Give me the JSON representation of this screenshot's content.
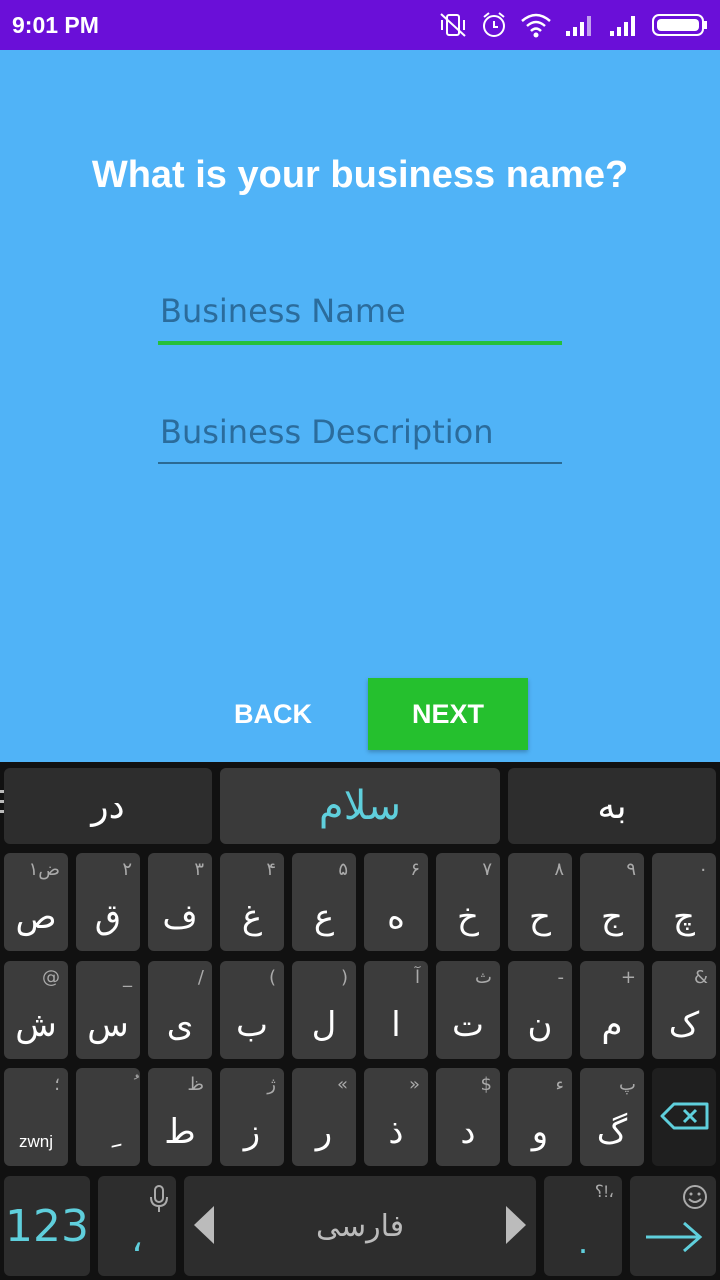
{
  "status_bar": {
    "time": "9:01 PM",
    "icons": [
      "vibrate-off-icon",
      "alarm-icon",
      "wifi-icon",
      "signal-icon",
      "signal-icon",
      "battery-icon"
    ]
  },
  "form": {
    "question": "What is your business name?",
    "name_placeholder": "Business Name",
    "description_placeholder": "Business Description",
    "back_label": "BACK",
    "next_label": "NEXT"
  },
  "colors": {
    "status_bar": "#6a0fd8",
    "background": "#50b3f7",
    "accent_green": "#25c02e",
    "keyboard_accent": "#5fcfdc"
  },
  "keyboard": {
    "suggestions": [
      "در",
      "سلام",
      "به"
    ],
    "row1": [
      {
        "main": "ص",
        "hint": "ض١"
      },
      {
        "main": "ق",
        "hint": "٢"
      },
      {
        "main": "ف",
        "hint": "٣"
      },
      {
        "main": "غ",
        "hint": "۴"
      },
      {
        "main": "ع",
        "hint": "۵"
      },
      {
        "main": "ه",
        "hint": "۶"
      },
      {
        "main": "خ",
        "hint": "٧"
      },
      {
        "main": "ح",
        "hint": "٨"
      },
      {
        "main": "ج",
        "hint": "٩"
      },
      {
        "main": "چ",
        "hint": "٠"
      }
    ],
    "row2": [
      {
        "main": "ش",
        "hint": "@"
      },
      {
        "main": "س",
        "hint": "_"
      },
      {
        "main": "ی",
        "hint": "/"
      },
      {
        "main": "ب",
        "hint": "("
      },
      {
        "main": "ل",
        "hint": ")"
      },
      {
        "main": "ا",
        "hint": "آ"
      },
      {
        "main": "ت",
        "hint": "ث"
      },
      {
        "main": "ن",
        "hint": "-"
      },
      {
        "main": "م",
        "hint": "+"
      },
      {
        "main": "ک",
        "hint": "&"
      }
    ],
    "row3": [
      {
        "main": "zwnj",
        "hint": "؛"
      },
      {
        "main": "ِ",
        "hint": "ُ"
      },
      {
        "main": "ط",
        "hint": "ظ"
      },
      {
        "main": "ز",
        "hint": "ژ"
      },
      {
        "main": "ر",
        "hint": "«"
      },
      {
        "main": "ذ",
        "hint": "»"
      },
      {
        "main": "د",
        "hint": "$"
      },
      {
        "main": "و",
        "hint": "ء"
      },
      {
        "main": "گ",
        "hint": "پ"
      }
    ],
    "numbers_label": "123",
    "comma_label": "،",
    "space_label": "فارسی",
    "period_label": ".",
    "period_hint": "؟!،"
  }
}
